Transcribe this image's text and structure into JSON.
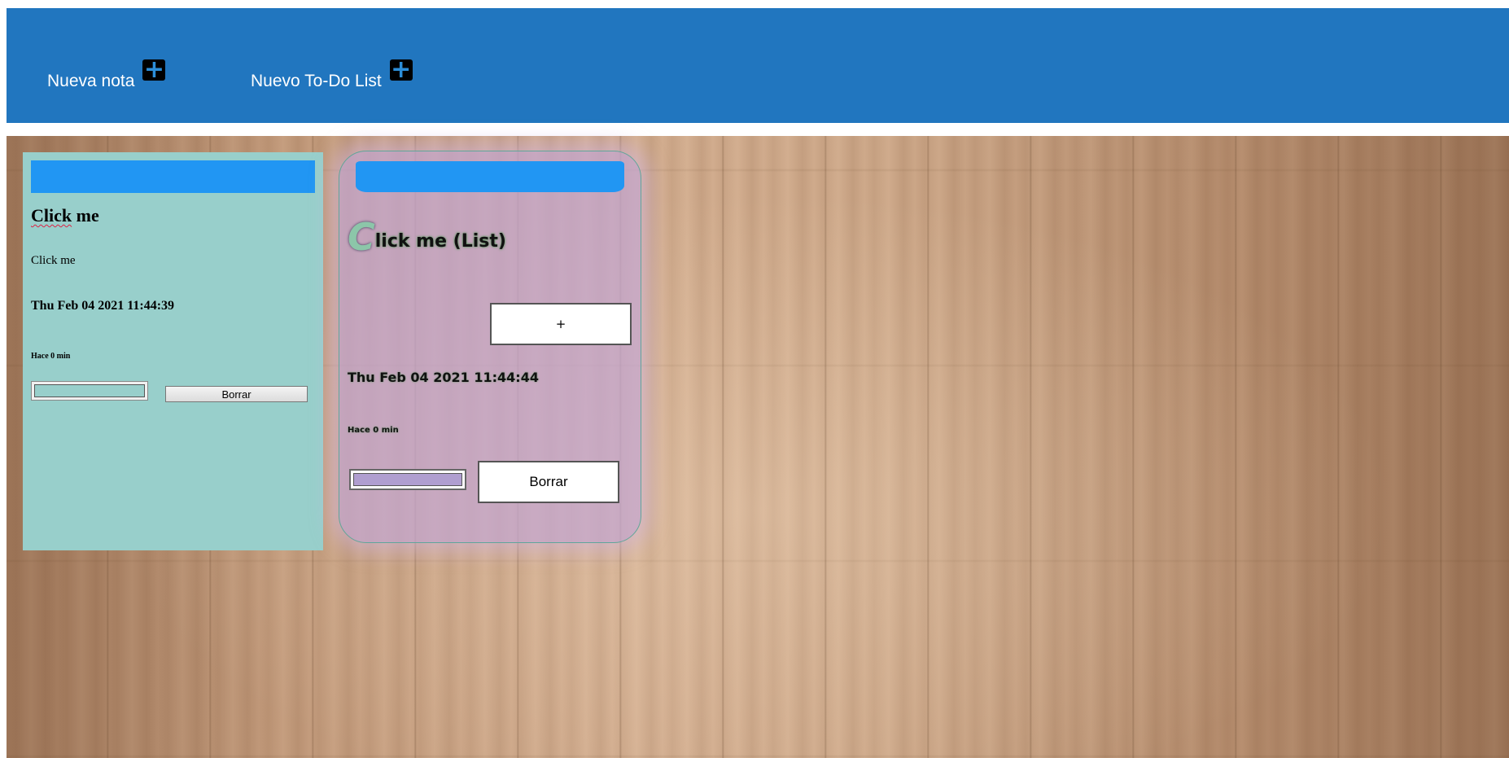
{
  "header": {
    "new_note_label": "Nueva nota",
    "new_note_icon": "+",
    "new_todo_label": "Nuevo To-Do List",
    "new_todo_icon": "+"
  },
  "note": {
    "title_word1": "Click",
    "title_word2": " me",
    "body": "Click me",
    "date": "Thu Feb 04 2021 11:44:39",
    "ago": "Hace 0 min",
    "color": "#98cfcb",
    "delete_label": "Borrar"
  },
  "todo": {
    "title_first": "C",
    "title_rest": "lick me (List)",
    "add_label": "+",
    "date": "Thu Feb 04 2021 11:44:44",
    "ago": "Hace 0 min",
    "color": "#b09ed0",
    "delete_label": "Borrar"
  },
  "colors": {
    "header_bg": "#2176bf",
    "drag_bar": "#2196f3",
    "note_bg": "#98cfcb",
    "todo_bg": "#c4a6d2"
  }
}
